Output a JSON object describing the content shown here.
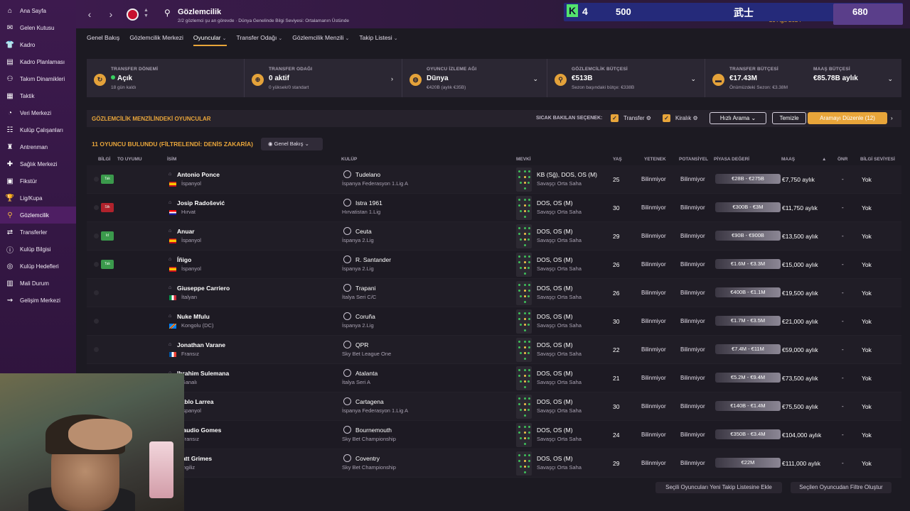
{
  "sidebar": {
    "items": [
      {
        "label": "Ana Sayfa",
        "icon": "home-icon",
        "glyph": "⌂"
      },
      {
        "label": "Gelen Kutusu",
        "icon": "inbox-icon",
        "glyph": "✉"
      },
      {
        "label": "Kadro",
        "icon": "shirt-icon",
        "glyph": "👕"
      },
      {
        "label": "Kadro Planlaması",
        "icon": "clipboard-icon",
        "glyph": "▤"
      },
      {
        "label": "Takım Dinamikleri",
        "icon": "network-icon",
        "glyph": "⚇"
      },
      {
        "label": "Taktik",
        "icon": "tactics-icon",
        "glyph": "▦"
      },
      {
        "label": "Veri Merkezi",
        "icon": "chart-circle-icon",
        "glyph": "◔"
      },
      {
        "label": "Kulüp Çalışanları",
        "icon": "staff-icon",
        "glyph": "☷"
      },
      {
        "label": "Antrenman",
        "icon": "training-icon",
        "glyph": "♜"
      },
      {
        "label": "Sağlık Merkezi",
        "icon": "medical-icon",
        "glyph": "✚"
      },
      {
        "label": "Fikstür",
        "icon": "calendar-icon",
        "glyph": "▣"
      },
      {
        "label": "Lig/Kupa",
        "icon": "trophy-icon",
        "glyph": "🏆"
      },
      {
        "label": "Gözlemcilik",
        "icon": "scouting-icon",
        "glyph": "⚲",
        "active": true
      },
      {
        "label": "Transferler",
        "icon": "transfer-icon",
        "glyph": "⇄"
      },
      {
        "label": "Kulüp Bilgisi",
        "icon": "club-info-icon",
        "glyph": "ⓘ"
      },
      {
        "label": "Kulüp Hedefleri",
        "icon": "objectives-icon",
        "glyph": "◎"
      },
      {
        "label": "Mali Durum",
        "icon": "finance-icon",
        "glyph": "▥"
      },
      {
        "label": "Gelişim Merkezi",
        "icon": "development-icon",
        "glyph": "⇝"
      }
    ]
  },
  "header": {
    "title": "Gözlemcilik",
    "subtitle": "2/2 gözlemci şu an görevde · Dünya Genelinde Bilgi Seviyesi: Ortalamanın Üstünde",
    "date": "29 Ağu 2024"
  },
  "stream_overlay": {
    "k_letter": "K",
    "k_count": "4",
    "coins": "500",
    "kanji": "武士",
    "points": "680"
  },
  "tabs": [
    {
      "label": "Genel Bakış",
      "dropdown": false
    },
    {
      "label": "Gözlemcilik Merkezi",
      "dropdown": false
    },
    {
      "label": "Oyuncular",
      "dropdown": true,
      "active": true
    },
    {
      "label": "Transfer Odağı",
      "dropdown": true
    },
    {
      "label": "Gözlemcilik Menzili",
      "dropdown": true
    },
    {
      "label": "Takip Listesi",
      "dropdown": true
    }
  ],
  "cards": {
    "transfer_window": {
      "label": "TRANSFER DÖNEMİ",
      "value": "Açık",
      "sub": "18 gün kaldı"
    },
    "transfer_focus": {
      "label": "TRANSFER ODAĞI",
      "value": "0 aktif",
      "sub": "0 yüksek/0 standart"
    },
    "scouting_network": {
      "label": "OYUNCU İZLEME AĞI",
      "value": "Dünya",
      "sub": "€420B (aylık €35B)"
    },
    "scouting_budget": {
      "label": "GÖZLEMCİLİK BÜTÇESİ",
      "value": "€513B",
      "sub": "Sezon başındaki bütçe: €338B"
    },
    "transfer_budget": {
      "label": "TRANSFER BÜTÇESİ",
      "value": "€17.43M",
      "sub": "Önümüzdeki Sezon: €3.38M"
    },
    "wage_budget": {
      "label": "MAAŞ BÜTÇESİ",
      "value": "€85.78B aylık"
    }
  },
  "section": {
    "title": "GÖZLEMCİLİK MENZİLİNDEKİ OYUNCULAR",
    "hot_label": "SICAK BAKILAN SEÇENEK:",
    "check_transfer": "Transfer",
    "check_loan": "Kiralık",
    "quick_search": "Hızlı Arama",
    "clear": "Temizle",
    "edit_search": "Aramayı Düzenle (12)"
  },
  "found_text": "11 OYUNCU BULUNDU (FİLTRELENDİ: DENİS ZAKARİA)",
  "view_button": "Genel Bakış",
  "columns": {
    "info": "BİLGİ",
    "fit": "TO UYUMU",
    "name": "İSİM",
    "club": "KULÜP",
    "position": "MEVKİ",
    "age": "YAŞ",
    "ability": "YETENEK",
    "potential": "POTANSİYEL",
    "value": "PİYASA DEĞERİ",
    "wage": "MAAŞ",
    "pref": "ÖNR",
    "knowledge": "BİLGİ SEVİYESİ"
  },
  "players": [
    {
      "tag": "Tak",
      "tag_color": "green",
      "name": "Antonio Ponce",
      "nation": "İspanyol",
      "flag": "es",
      "club": "Tudelano",
      "league": "İspanya Federasyon 1.Lig A",
      "pos": "KB (Sğ), DOS, OS (M)",
      "role": "Savaşçı Orta Saha",
      "age": "25",
      "ability": "Bilinmiyor",
      "potential": "Bilinmiyor",
      "value": "€28B - €275B",
      "wage": "€7,750 aylık",
      "pref": "-",
      "knowledge": "Yok"
    },
    {
      "tag": "Stk",
      "tag_color": "red",
      "name": "Josip Radošević",
      "nation": "Hırvat",
      "flag": "hr",
      "club": "Istra 1961",
      "league": "Hırvatistan 1.Lig",
      "pos": "DOS, OS (M)",
      "role": "Savaşçı Orta Saha",
      "age": "30",
      "ability": "Bilinmiyor",
      "potential": "Bilinmiyor",
      "value": "€300B - €3M",
      "wage": "€11,750 aylık",
      "pref": "-",
      "knowledge": "Yok"
    },
    {
      "tag": "Id",
      "tag_color": "green",
      "name": "Anuar",
      "nation": "İspanyol",
      "flag": "es",
      "club": "Ceuta",
      "league": "İspanya 2.Lig",
      "pos": "DOS, OS (M)",
      "role": "Savaşçı Orta Saha",
      "age": "29",
      "ability": "Bilinmiyor",
      "potential": "Bilinmiyor",
      "value": "€90B - €900B",
      "wage": "€13,500 aylık",
      "pref": "-",
      "knowledge": "Yok"
    },
    {
      "tag": "Tak",
      "tag_color": "green",
      "name": "Íñigo",
      "nation": "İspanyol",
      "flag": "es",
      "club": "R. Santander",
      "league": "İspanya 2.Lig",
      "pos": "DOS, OS (M)",
      "role": "Savaşçı Orta Saha",
      "age": "26",
      "ability": "Bilinmiyor",
      "potential": "Bilinmiyor",
      "value": "€1.6M - €3.3M",
      "wage": "€15,000 aylık",
      "pref": "-",
      "knowledge": "Yok"
    },
    {
      "tag": "",
      "tag_color": "",
      "name": "Giuseppe Carriero",
      "nation": "İtalyan",
      "flag": "it",
      "club": "Trapani",
      "league": "İtalya Seri C/C",
      "pos": "DOS, OS (M)",
      "role": "Savaşçı Orta Saha",
      "age": "26",
      "ability": "Bilinmiyor",
      "potential": "Bilinmiyor",
      "value": "€400B - €1.1M",
      "wage": "€19,500 aylık",
      "pref": "-",
      "knowledge": "Yok"
    },
    {
      "tag": "",
      "tag_color": "",
      "name": "Nuke Mfulu",
      "nation": "Kongolu (DC)",
      "flag": "cd",
      "club": "Coruña",
      "league": "İspanya 2.Lig",
      "pos": "DOS, OS (M)",
      "role": "Savaşçı Orta Saha",
      "age": "30",
      "ability": "Bilinmiyor",
      "potential": "Bilinmiyor",
      "value": "€1.7M - €3.5M",
      "wage": "€21,000 aylık",
      "pref": "-",
      "knowledge": "Yok"
    },
    {
      "tag": "",
      "tag_color": "",
      "name": "Jonathan Varane",
      "nation": "Fransız",
      "flag": "fr",
      "club": "QPR",
      "league": "Sky Bet League One",
      "pos": "DOS, OS (M)",
      "role": "Savaşçı Orta Saha",
      "age": "22",
      "ability": "Bilinmiyor",
      "potential": "Bilinmiyor",
      "value": "€7.4M - €11M",
      "wage": "€59,000 aylık",
      "pref": "-",
      "knowledge": "Yok"
    },
    {
      "tag": "",
      "tag_color": "",
      "name": "Ibrahim Sulemana",
      "nation": "Ganalı",
      "flag": "gh",
      "club": "Atalanta",
      "league": "İtalya Seri A",
      "pos": "DOS, OS (M)",
      "role": "Savaşçı Orta Saha",
      "age": "21",
      "ability": "Bilinmiyor",
      "potential": "Bilinmiyor",
      "value": "€5.2M - €9.4M",
      "wage": "€73,500 aylık",
      "pref": "-",
      "knowledge": "Yok"
    },
    {
      "tag": "",
      "tag_color": "",
      "name": "Pablo Larrea",
      "nation": "İspanyol",
      "flag": "es",
      "club": "Cartagena",
      "league": "İspanya Federasyon 1.Lig A",
      "pos": "DOS, OS (M)",
      "role": "Savaşçı Orta Saha",
      "age": "30",
      "ability": "Bilinmiyor",
      "potential": "Bilinmiyor",
      "value": "€140B - €1.4M",
      "wage": "€75,500 aylık",
      "pref": "-",
      "knowledge": "Yok"
    },
    {
      "tag": "",
      "tag_color": "",
      "name": "Claudio Gomes",
      "nation": "Fransız",
      "flag": "fr",
      "club": "Bournemouth",
      "league": "Sky Bet Championship",
      "pos": "DOS, OS (M)",
      "role": "Savaşçı Orta Saha",
      "age": "24",
      "ability": "Bilinmiyor",
      "potential": "Bilinmiyor",
      "value": "€350B - €3.4M",
      "wage": "€104,000 aylık",
      "pref": "-",
      "knowledge": "Yok"
    },
    {
      "tag": "",
      "tag_color": "",
      "name": "Matt Grimes",
      "nation": "İngiliz",
      "flag": "en",
      "club": "Coventry",
      "league": "Sky Bet Championship",
      "pos": "DOS, OS (M)",
      "role": "Savaşçı Orta Saha",
      "age": "29",
      "ability": "Bilinmiyor",
      "potential": "Bilinmiyor",
      "value": "€22M",
      "wage": "€111,000 aylık",
      "pref": "-",
      "knowledge": "Yok"
    }
  ],
  "footer": {
    "add_to_list": "Seçili Oyuncuları Yeni Takip Listesine Ekle",
    "filter_from_selected": "Seçilen Oyuncudan Filtre Oluştur"
  },
  "colors": {
    "accent": "#e8a53a",
    "sidebar": "#3d1a4e",
    "tag_green": "#3b9a4c",
    "tag_red": "#b0222c"
  }
}
